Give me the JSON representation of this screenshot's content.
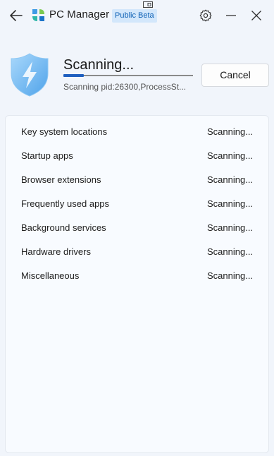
{
  "app": {
    "title": "PC Manager",
    "badge": "Public Beta"
  },
  "scan": {
    "title": "Scanning...",
    "detail": "Scanning pid:26300,ProcessSt...",
    "progress_percent": 16,
    "cancel_label": "Cancel"
  },
  "items": [
    {
      "label": "Key system locations",
      "status": "Scanning..."
    },
    {
      "label": "Startup apps",
      "status": "Scanning..."
    },
    {
      "label": "Browser extensions",
      "status": "Scanning..."
    },
    {
      "label": "Frequently used apps",
      "status": "Scanning..."
    },
    {
      "label": "Background services",
      "status": "Scanning..."
    },
    {
      "label": "Hardware drivers",
      "status": "Scanning..."
    },
    {
      "label": "Miscellaneous",
      "status": "Scanning..."
    }
  ],
  "icons": {
    "back": "back-arrow-icon",
    "logo": "pc-manager-logo-icon",
    "settings": "gear-icon",
    "minimize": "minimize-icon",
    "close": "close-icon",
    "shield": "shield-lightning-icon"
  },
  "colors": {
    "accent": "#1f5fbf",
    "badge_bg": "#d3e7fb",
    "badge_text": "#0b5fb4",
    "shield": "#6fb8f0"
  }
}
